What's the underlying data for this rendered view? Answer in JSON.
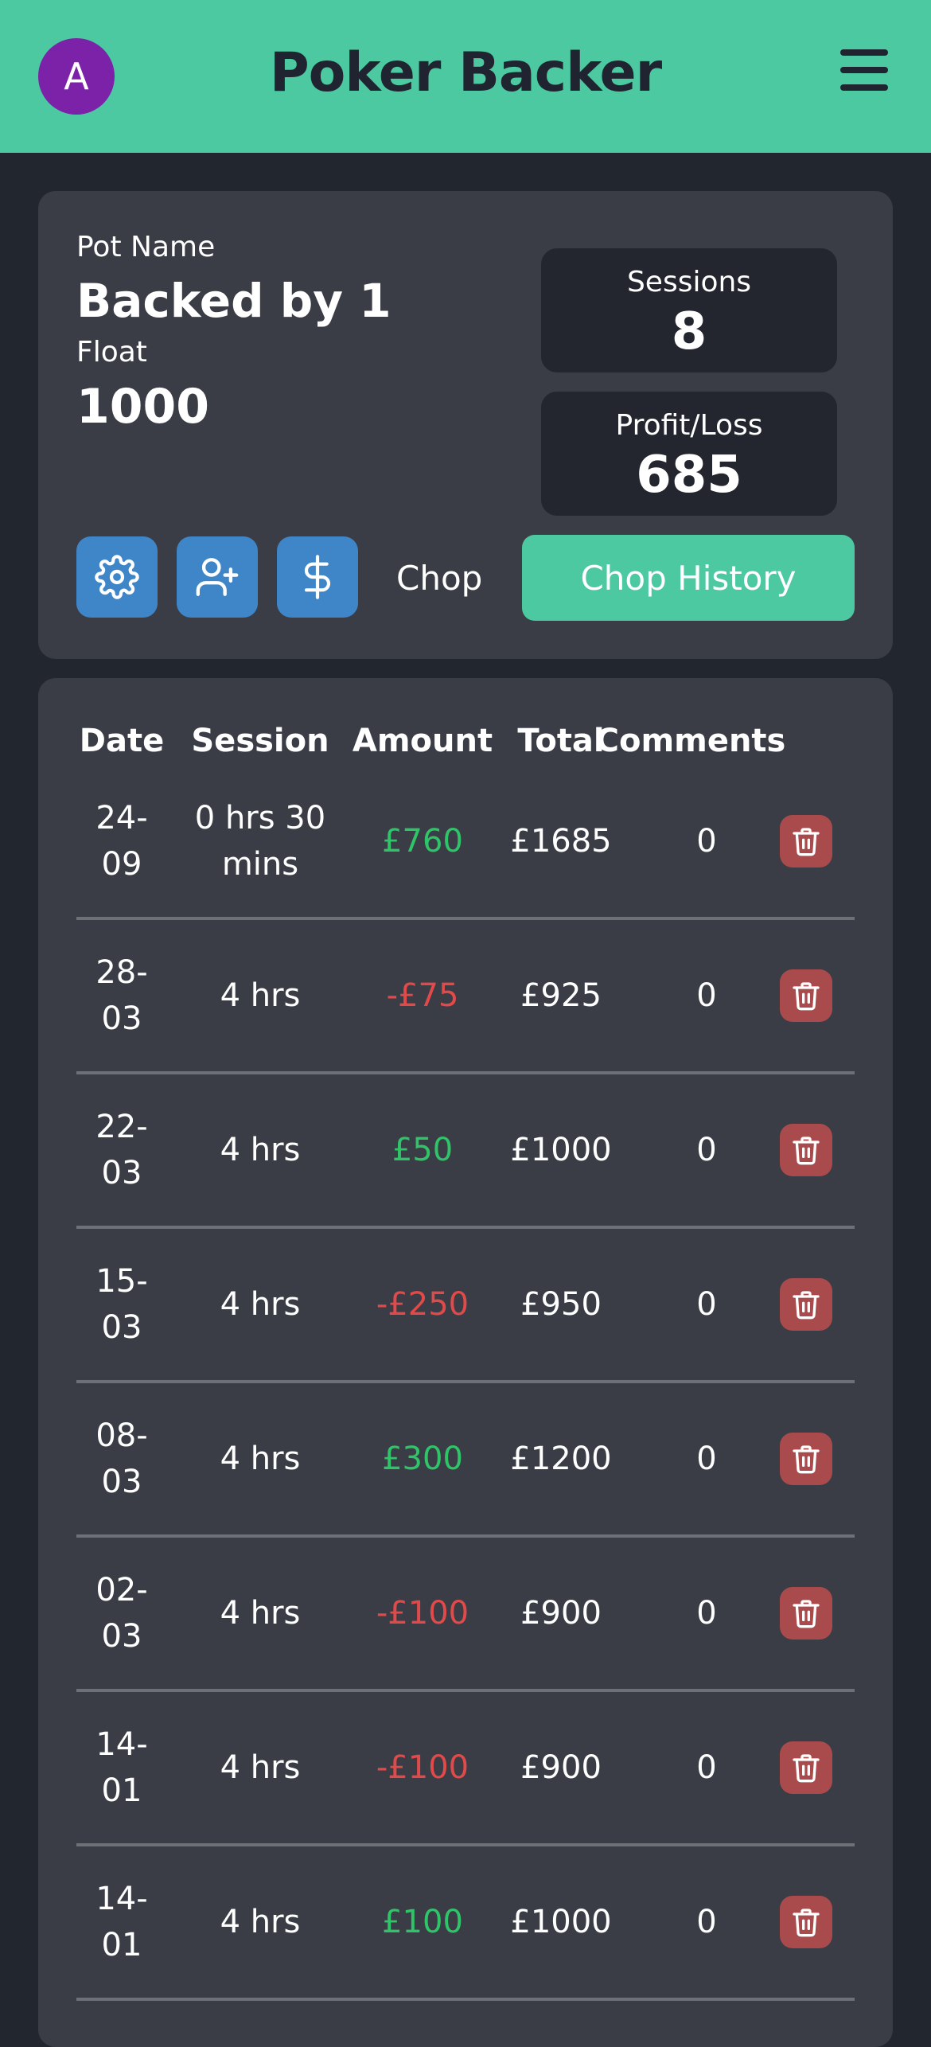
{
  "header": {
    "avatar_initial": "A",
    "title": "Poker Backer",
    "menu_icon": "hamburger-menu-icon"
  },
  "pot": {
    "name_label": "Pot Name",
    "name": "Backed by 1",
    "float_label": "Float",
    "float": "1000",
    "sessions_label": "Sessions",
    "sessions": "8",
    "profit_label": "Profit/Loss",
    "profit": "685",
    "actions": {
      "settings_icon": "gear-icon",
      "add_user_icon": "user-plus-icon",
      "dollar_icon": "dollar-icon",
      "chop_label": "Chop",
      "chop_history_label": "Chop History"
    }
  },
  "table": {
    "headers": [
      "Date",
      "Session",
      "Amount",
      "Total",
      "Comments"
    ],
    "rows": [
      {
        "date": "24-\n09",
        "session": "0 hrs 30\nmins",
        "amount": "£760",
        "total": "£1685",
        "comments": "0",
        "positive": true
      },
      {
        "date": "28-\n03",
        "session": "4 hrs",
        "amount": "-£75",
        "total": "£925",
        "comments": "0",
        "positive": false
      },
      {
        "date": "22-\n03",
        "session": "4 hrs",
        "amount": "£50",
        "total": "£1000",
        "comments": "0",
        "positive": true
      },
      {
        "date": "15-\n03",
        "session": "4 hrs",
        "amount": "-£250",
        "total": "£950",
        "comments": "0",
        "positive": false
      },
      {
        "date": "08-\n03",
        "session": "4 hrs",
        "amount": "£300",
        "total": "£1200",
        "comments": "0",
        "positive": true
      },
      {
        "date": "02-\n03",
        "session": "4 hrs",
        "amount": "-£100",
        "total": "£900",
        "comments": "0",
        "positive": false
      },
      {
        "date": "14-\n01",
        "session": "4 hrs",
        "amount": "-£100",
        "total": "£900",
        "comments": "0",
        "positive": false
      },
      {
        "date": "14-\n01",
        "session": "4 hrs",
        "amount": "£100",
        "total": "£1000",
        "comments": "0",
        "positive": true
      }
    ],
    "delete_icon": "trash-icon"
  },
  "colors": {
    "accent": "#4cc9a0",
    "positive": "#30c469",
    "negative": "#e24a4a",
    "button_blue": "#3f86c9",
    "delete_red": "#a94b4c"
  }
}
